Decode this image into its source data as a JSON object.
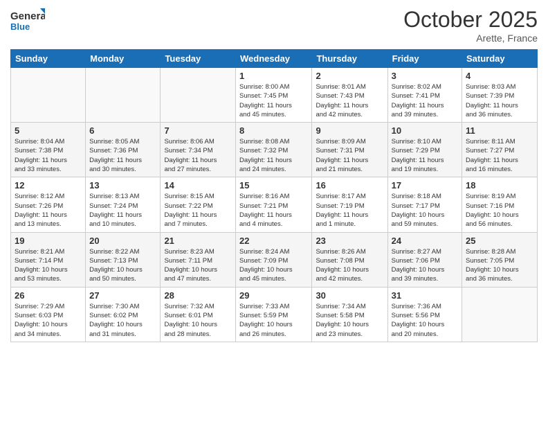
{
  "header": {
    "logo_general": "General",
    "logo_blue": "Blue",
    "month": "October 2025",
    "location": "Arette, France"
  },
  "days_of_week": [
    "Sunday",
    "Monday",
    "Tuesday",
    "Wednesday",
    "Thursday",
    "Friday",
    "Saturday"
  ],
  "weeks": [
    {
      "days": [
        {
          "num": "",
          "info": ""
        },
        {
          "num": "",
          "info": ""
        },
        {
          "num": "",
          "info": ""
        },
        {
          "num": "1",
          "info": "Sunrise: 8:00 AM\nSunset: 7:45 PM\nDaylight: 11 hours\nand 45 minutes."
        },
        {
          "num": "2",
          "info": "Sunrise: 8:01 AM\nSunset: 7:43 PM\nDaylight: 11 hours\nand 42 minutes."
        },
        {
          "num": "3",
          "info": "Sunrise: 8:02 AM\nSunset: 7:41 PM\nDaylight: 11 hours\nand 39 minutes."
        },
        {
          "num": "4",
          "info": "Sunrise: 8:03 AM\nSunset: 7:39 PM\nDaylight: 11 hours\nand 36 minutes."
        }
      ]
    },
    {
      "days": [
        {
          "num": "5",
          "info": "Sunrise: 8:04 AM\nSunset: 7:38 PM\nDaylight: 11 hours\nand 33 minutes."
        },
        {
          "num": "6",
          "info": "Sunrise: 8:05 AM\nSunset: 7:36 PM\nDaylight: 11 hours\nand 30 minutes."
        },
        {
          "num": "7",
          "info": "Sunrise: 8:06 AM\nSunset: 7:34 PM\nDaylight: 11 hours\nand 27 minutes."
        },
        {
          "num": "8",
          "info": "Sunrise: 8:08 AM\nSunset: 7:32 PM\nDaylight: 11 hours\nand 24 minutes."
        },
        {
          "num": "9",
          "info": "Sunrise: 8:09 AM\nSunset: 7:31 PM\nDaylight: 11 hours\nand 21 minutes."
        },
        {
          "num": "10",
          "info": "Sunrise: 8:10 AM\nSunset: 7:29 PM\nDaylight: 11 hours\nand 19 minutes."
        },
        {
          "num": "11",
          "info": "Sunrise: 8:11 AM\nSunset: 7:27 PM\nDaylight: 11 hours\nand 16 minutes."
        }
      ]
    },
    {
      "days": [
        {
          "num": "12",
          "info": "Sunrise: 8:12 AM\nSunset: 7:26 PM\nDaylight: 11 hours\nand 13 minutes."
        },
        {
          "num": "13",
          "info": "Sunrise: 8:13 AM\nSunset: 7:24 PM\nDaylight: 11 hours\nand 10 minutes."
        },
        {
          "num": "14",
          "info": "Sunrise: 8:15 AM\nSunset: 7:22 PM\nDaylight: 11 hours\nand 7 minutes."
        },
        {
          "num": "15",
          "info": "Sunrise: 8:16 AM\nSunset: 7:21 PM\nDaylight: 11 hours\nand 4 minutes."
        },
        {
          "num": "16",
          "info": "Sunrise: 8:17 AM\nSunset: 7:19 PM\nDaylight: 11 hours\nand 1 minute."
        },
        {
          "num": "17",
          "info": "Sunrise: 8:18 AM\nSunset: 7:17 PM\nDaylight: 10 hours\nand 59 minutes."
        },
        {
          "num": "18",
          "info": "Sunrise: 8:19 AM\nSunset: 7:16 PM\nDaylight: 10 hours\nand 56 minutes."
        }
      ]
    },
    {
      "days": [
        {
          "num": "19",
          "info": "Sunrise: 8:21 AM\nSunset: 7:14 PM\nDaylight: 10 hours\nand 53 minutes."
        },
        {
          "num": "20",
          "info": "Sunrise: 8:22 AM\nSunset: 7:13 PM\nDaylight: 10 hours\nand 50 minutes."
        },
        {
          "num": "21",
          "info": "Sunrise: 8:23 AM\nSunset: 7:11 PM\nDaylight: 10 hours\nand 47 minutes."
        },
        {
          "num": "22",
          "info": "Sunrise: 8:24 AM\nSunset: 7:09 PM\nDaylight: 10 hours\nand 45 minutes."
        },
        {
          "num": "23",
          "info": "Sunrise: 8:26 AM\nSunset: 7:08 PM\nDaylight: 10 hours\nand 42 minutes."
        },
        {
          "num": "24",
          "info": "Sunrise: 8:27 AM\nSunset: 7:06 PM\nDaylight: 10 hours\nand 39 minutes."
        },
        {
          "num": "25",
          "info": "Sunrise: 8:28 AM\nSunset: 7:05 PM\nDaylight: 10 hours\nand 36 minutes."
        }
      ]
    },
    {
      "days": [
        {
          "num": "26",
          "info": "Sunrise: 7:29 AM\nSunset: 6:03 PM\nDaylight: 10 hours\nand 34 minutes."
        },
        {
          "num": "27",
          "info": "Sunrise: 7:30 AM\nSunset: 6:02 PM\nDaylight: 10 hours\nand 31 minutes."
        },
        {
          "num": "28",
          "info": "Sunrise: 7:32 AM\nSunset: 6:01 PM\nDaylight: 10 hours\nand 28 minutes."
        },
        {
          "num": "29",
          "info": "Sunrise: 7:33 AM\nSunset: 5:59 PM\nDaylight: 10 hours\nand 26 minutes."
        },
        {
          "num": "30",
          "info": "Sunrise: 7:34 AM\nSunset: 5:58 PM\nDaylight: 10 hours\nand 23 minutes."
        },
        {
          "num": "31",
          "info": "Sunrise: 7:36 AM\nSunset: 5:56 PM\nDaylight: 10 hours\nand 20 minutes."
        },
        {
          "num": "",
          "info": ""
        }
      ]
    }
  ]
}
